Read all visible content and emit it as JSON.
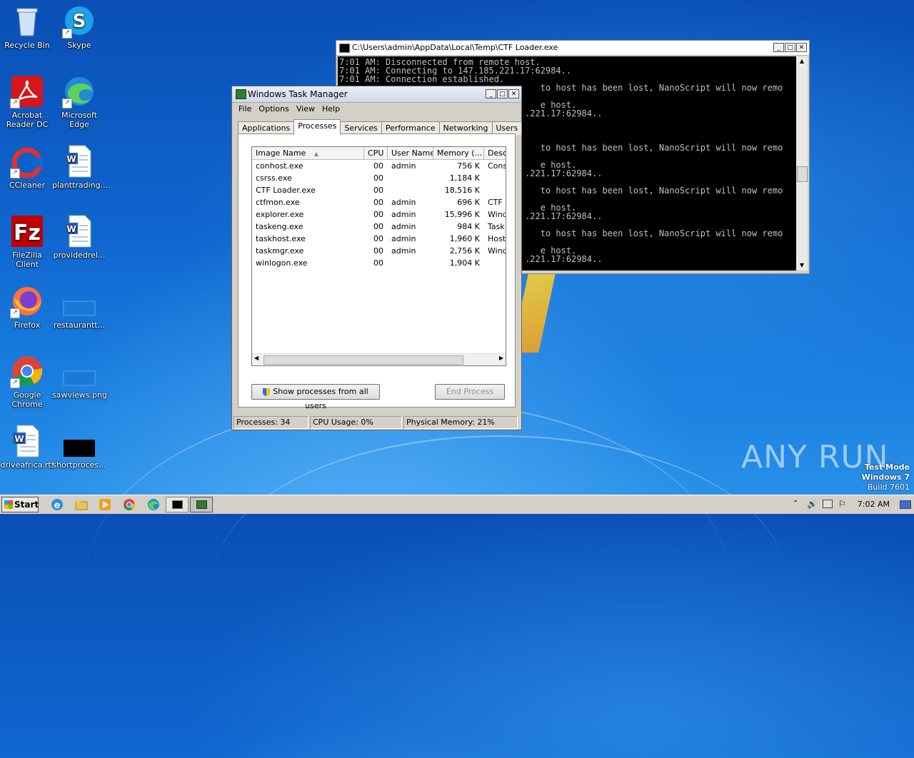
{
  "desktop": {
    "icons": [
      {
        "label": "Recycle Bin"
      },
      {
        "label": "Skype"
      },
      {
        "label": "Acrobat Reader DC"
      },
      {
        "label": "Microsoft Edge"
      },
      {
        "label": "CCleaner"
      },
      {
        "label": "planttrading...."
      },
      {
        "label": "FileZilla Client"
      },
      {
        "label": "providedrel..."
      },
      {
        "label": "Firefox"
      },
      {
        "label": "restaurantt..."
      },
      {
        "label": "Google Chrome"
      },
      {
        "label": "sawviews.png"
      },
      {
        "label": "driveafrica.rtf"
      },
      {
        "label": "shortproces..."
      }
    ]
  },
  "console": {
    "title": "C:\\Users\\admin\\AppData\\Local\\Temp\\CTF Loader.exe",
    "lines": [
      "7:01 AM: Disconnected from remote host.",
      "7:01 AM: Connecting to 147.185.221.17:62984..",
      "7:01 AM: Connection established.",
      "                                       to host has been lost, NanoScript will now remo",
      "",
      "                                       e host.",
      "                                    .221.17:62984..",
      "",
      "",
      "",
      "                                       to host has been lost, NanoScript will now remo",
      "",
      "                                       e host.",
      "                                    .221.17:62984..",
      "",
      "                                       to host has been lost, NanoScript will now remo",
      "",
      "                                       e host.",
      "                                    .221.17:62984..",
      "",
      "                                       to host has been lost, NanoScript will now remo",
      "",
      "                                       e host.",
      "                                    .221.17:62984.."
    ]
  },
  "taskmgr": {
    "title": "Windows Task Manager",
    "menu": [
      "File",
      "Options",
      "View",
      "Help"
    ],
    "tabs": [
      "Applications",
      "Processes",
      "Services",
      "Performance",
      "Networking",
      "Users"
    ],
    "active_tab": "Processes",
    "columns": [
      "Image Name",
      "CPU",
      "User Name",
      "Memory (...",
      "Desc"
    ],
    "rows": [
      {
        "name": "conhost.exe",
        "cpu": "00",
        "user": "admin",
        "mem": "756 K",
        "desc": "Cons"
      },
      {
        "name": "csrss.exe",
        "cpu": "00",
        "user": "",
        "mem": "1,184 K",
        "desc": ""
      },
      {
        "name": "CTF Loader.exe",
        "cpu": "00",
        "user": "",
        "mem": "18,516 K",
        "desc": ""
      },
      {
        "name": "ctfmon.exe",
        "cpu": "00",
        "user": "admin",
        "mem": "696 K",
        "desc": "CTF I"
      },
      {
        "name": "explorer.exe",
        "cpu": "00",
        "user": "admin",
        "mem": "15,996 K",
        "desc": "Wind"
      },
      {
        "name": "taskeng.exe",
        "cpu": "00",
        "user": "admin",
        "mem": "984 K",
        "desc": "Task"
      },
      {
        "name": "taskhost.exe",
        "cpu": "00",
        "user": "admin",
        "mem": "1,960 K",
        "desc": "Host"
      },
      {
        "name": "taskmgr.exe",
        "cpu": "00",
        "user": "admin",
        "mem": "2,756 K",
        "desc": "Wind"
      },
      {
        "name": "winlogon.exe",
        "cpu": "00",
        "user": "",
        "mem": "1,904 K",
        "desc": ""
      }
    ],
    "show_all_button": "Show processes from all users",
    "end_process_button": "End Process",
    "status": {
      "processes": "Processes: 34",
      "cpu": "CPU Usage: 0%",
      "memory": "Physical Memory: 21%"
    }
  },
  "taskbar": {
    "start_label": "Start",
    "clock": "7:02 AM"
  },
  "watermark": {
    "brand": "ANY RUN",
    "test_mode": "Test Mode",
    "os": "Windows 7",
    "build": "Build 7601"
  }
}
